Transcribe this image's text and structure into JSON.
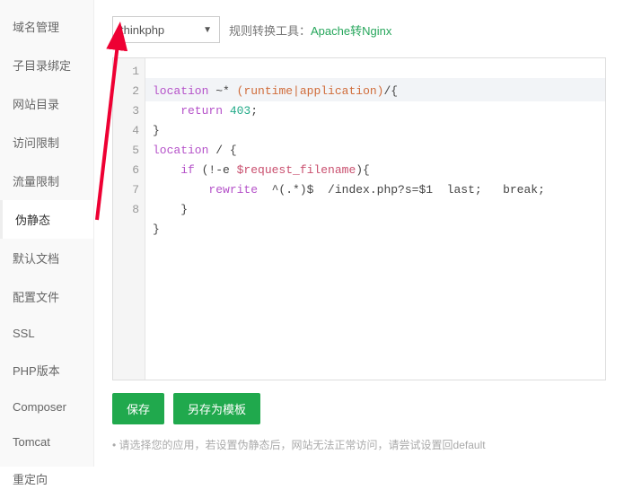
{
  "sidebar": {
    "items": [
      {
        "label": "域名管理"
      },
      {
        "label": "子目录绑定"
      },
      {
        "label": "网站目录"
      },
      {
        "label": "访问限制"
      },
      {
        "label": "流量限制"
      },
      {
        "label": "伪静态"
      },
      {
        "label": "默认文档"
      },
      {
        "label": "配置文件"
      },
      {
        "label": "SSL"
      },
      {
        "label": "PHP版本"
      },
      {
        "label": "Composer"
      },
      {
        "label": "Tomcat"
      },
      {
        "label": "重定向"
      }
    ],
    "active_index": 5
  },
  "toolbar": {
    "select_value": "thinkphp",
    "tool_label": "规则转换工具：",
    "tool_link": "Apache转Nginx"
  },
  "code": {
    "line_numbers": [
      "1",
      "2",
      "3",
      "4",
      "5",
      "6",
      "7",
      "8"
    ],
    "l1_a": "location",
    "l1_b": " ~* ",
    "l1_c": "(runtime|application)",
    "l1_d": "/{",
    "l2_a": "    return",
    "l2_b": " 403",
    "l2_c": ";",
    "l3": "}",
    "l4_a": "location",
    "l4_b": " / {",
    "l5_a": "    if",
    "l5_b": " (!-e ",
    "l5_c": "$request_filename",
    "l5_d": "){",
    "l6_a": "        rewrite",
    "l6_b": "  ^(.*)$  /index.php?s=$1  last;   break;",
    "l7": "    }",
    "l8": "}"
  },
  "buttons": {
    "save": "保存",
    "save_as": "另存为模板"
  },
  "tip": "请选择您的应用，若设置伪静态后，网站无法正常访问，请尝试设置回default"
}
